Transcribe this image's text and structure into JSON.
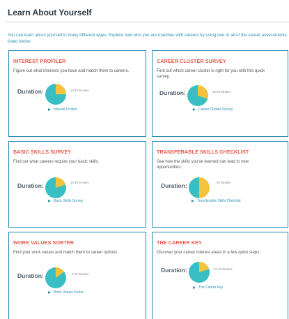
{
  "page": {
    "title": "Learn About Yourself",
    "intro": "You can learn about yourself in many different ways. Explore how who you are matches with careers by using one or all of the career assessments listed below."
  },
  "colors": {
    "accent": "#1f88b3",
    "card_title": "#e8584a",
    "link": "#2b8fb3",
    "pie_teal": "#39bfc3",
    "pie_yellow": "#f4c33b"
  },
  "duration_label": "Duration:",
  "cards": [
    {
      "title": "INTEREST PROFILER",
      "description": "Figure out what interests you have and match them to careers.",
      "duration": "10-20 minutes",
      "link": "Interest Profiler",
      "pie_fraction": 0.25
    },
    {
      "title": "CAREER CLUSTER SURVEY",
      "description": "Find out which career cluster is right for you with this quick survey.",
      "duration": "15-20 minutes",
      "link": "Career Cluster Survey",
      "pie_fraction": 0.3
    },
    {
      "title": "BASIC SKILLS SURVEY",
      "description": "Find out what careers require your basic skills.",
      "duration": "10-15 minutes",
      "link": "Basic Skills Survey",
      "pie_fraction": 0.2
    },
    {
      "title": "TRANSFERABLE SKILLS CHECKLIST",
      "description": "See how the skills you've learned can lead to new opportunities.",
      "duration": "30 minutes",
      "link": "Transferable Skills Checklist",
      "pie_fraction": 0.5
    },
    {
      "title": "WORK VALUES SORTER",
      "description": "Find your work values and match them to career options.",
      "duration": "5-15 minutes",
      "link": "Work Values Sorter",
      "pie_fraction": 0.15
    },
    {
      "title": "THE CAREER KEY",
      "description": "Discover your career interest areas in a few quick steps.",
      "duration": "10-15 minutes",
      "link": "The Career Key",
      "pie_fraction": 0.2
    }
  ]
}
